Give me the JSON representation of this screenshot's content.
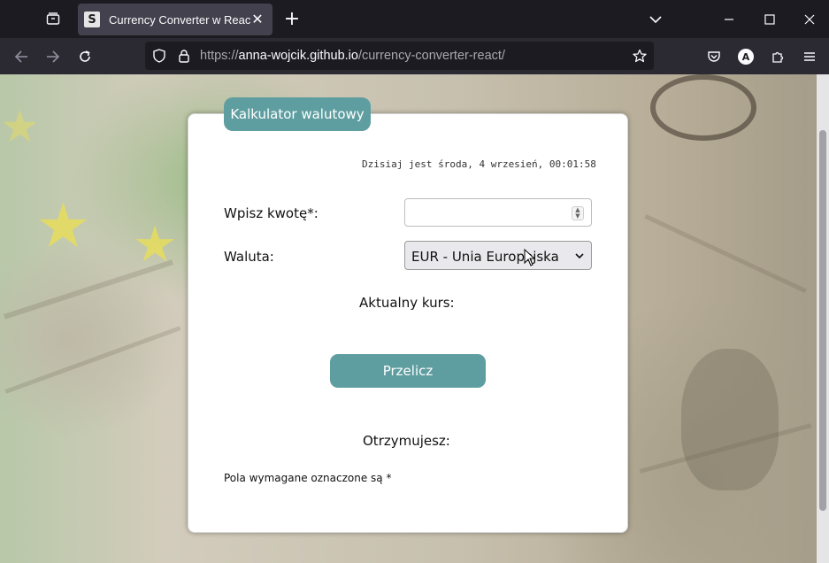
{
  "browser": {
    "tab": {
      "favicon_letter": "S",
      "title": "Currency Converter w React.js"
    },
    "url": {
      "scheme": "https://",
      "host": "anna-wojcik.github.io",
      "path": "/currency-converter-react/"
    },
    "icons": {
      "tab_overview": "tab-overview-icon",
      "close": "close-icon",
      "new_tab": "plus-icon",
      "list_all_tabs": "chevron-down-icon",
      "back": "arrow-left-icon",
      "forward": "arrow-right-icon",
      "reload": "reload-icon",
      "tracking_protection": "shield-icon",
      "lock": "lock-icon",
      "bookmark": "star-icon",
      "pocket": "pocket-icon",
      "account": "account-icon",
      "extensions": "puzzle-icon",
      "menu": "hamburger-icon"
    },
    "account_letter": "A"
  },
  "calculator": {
    "legend": "Kalkulator walutowy",
    "date_text": "Dzisiaj jest środa, 4 wrzesień, 00:01:58",
    "amount_label": "Wpisz kwotę*:",
    "amount_value": "",
    "currency_label": "Waluta:",
    "currency_selected": "EUR - Unia Europejska",
    "rate_label": "Aktualny kurs:",
    "convert_button": "Przelicz",
    "result_label": "Otrzymujesz:",
    "required_note": "Pola wymagane oznaczone są *"
  },
  "colors": {
    "accent": "#5f9ea0",
    "browser_dark": "#1c1b22",
    "toolbar": "#2b2a33"
  }
}
